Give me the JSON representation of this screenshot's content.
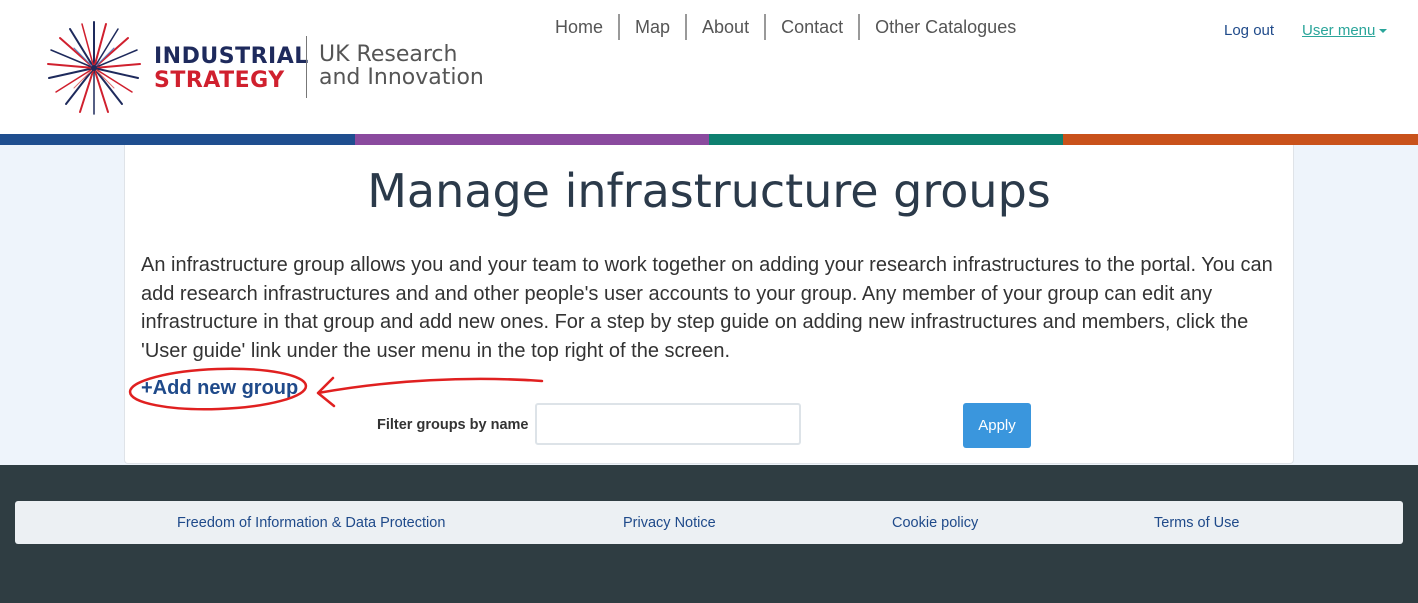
{
  "header": {
    "logo": {
      "line1": "INDUSTRIAL",
      "line2": "STRATEGY",
      "org_line1": "UK Research",
      "org_line2": "and Innovation"
    },
    "nav": [
      {
        "label": "Home"
      },
      {
        "label": "Map"
      },
      {
        "label": "About"
      },
      {
        "label": "Contact"
      },
      {
        "label": "Other Catalogues"
      }
    ],
    "logout_label": "Log out",
    "user_menu_label": "User menu"
  },
  "colors": {
    "stripe": [
      "#1f4e8f",
      "#8a4a9e",
      "#0e8070",
      "#c9521b"
    ],
    "accent": "#1f4a8a",
    "button": "#3a96dd",
    "annotation": "#e02020"
  },
  "main": {
    "title": "Manage infrastructure groups",
    "intro": "An infrastructure group allows you and your team to work together on adding your research infrastructures to the portal. You can add research infrastructures and and other people's user accounts to your group. Any member of your group can edit any infrastructure in that group and add new ones. For a step by step guide on adding new infrastructures and members, click the 'User guide' link under the user menu in the top right of the screen.",
    "add_group_label": "+Add new group",
    "filter_label": "Filter groups by name",
    "filter_value": "",
    "filter_placeholder": "",
    "apply_label": "Apply"
  },
  "footer": {
    "links": [
      {
        "label": "Freedom of Information & Data Protection"
      },
      {
        "label": "Privacy Notice"
      },
      {
        "label": "Cookie policy"
      },
      {
        "label": "Terms of Use"
      }
    ]
  }
}
